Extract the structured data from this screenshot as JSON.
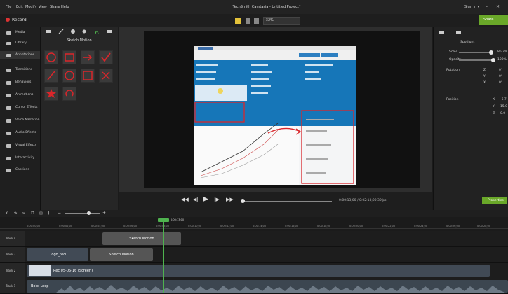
{
  "menubar": {
    "items": [
      "File",
      "Edit",
      "Modify",
      "View",
      "Share",
      "Help"
    ],
    "title": "TechSmith Camtasia - Untitled Project*",
    "user": "Sign In ▾"
  },
  "toolbar": {
    "record_label": "Record",
    "zoom": "32%",
    "share_label": "Share"
  },
  "sidebar": {
    "items": [
      {
        "label": "Media"
      },
      {
        "label": "Library"
      },
      {
        "label": "Annotations"
      },
      {
        "label": "Transitions"
      },
      {
        "label": "Behaviors"
      },
      {
        "label": "Animations"
      },
      {
        "label": "Cursor Effects"
      },
      {
        "label": "Voice Narration"
      },
      {
        "label": "Audio Effects"
      },
      {
        "label": "Visual Effects"
      },
      {
        "label": "Interactivity"
      },
      {
        "label": "Captions"
      }
    ]
  },
  "annotations": {
    "panel_title": "Sketch Motion",
    "accent": "#d9262b"
  },
  "rightpanel": {
    "title": "Spotlight",
    "scale_label": "Scale",
    "scale_value": "85.7%",
    "opacity_label": "Opacity",
    "opacity_value": "100%",
    "rotation_label": "Rotation",
    "rot_values": [
      "0°",
      "0°",
      "0°"
    ],
    "position_label": "Position",
    "pos_values": [
      "-6.7",
      "15.0",
      "0.0"
    ],
    "axis_labels": [
      "X",
      "Y",
      "Z"
    ],
    "properties_label": "Properties"
  },
  "playback": {
    "time": "0:00:13;00 / 0:02:13;00  30fps"
  },
  "screenshot": {
    "header_text": "Find, compare and share the latest OECD data: charts, maps, tables and related publications",
    "search_label": "Browse by",
    "topic_btn": "Topic",
    "country_btn": "Country",
    "topics_left": [
      "Agriculture",
      "Development",
      "Economy",
      "Education",
      "Employment"
    ],
    "topics_mid": [
      "Energy",
      "Environment",
      "Finance",
      "Government",
      "Health"
    ],
    "topics_right": [
      "Innovation and Technology",
      "Jobs",
      "Society"
    ],
    "right_col_labels": [
      "Selected indicators",
      "Related topic",
      "Statistical Insight",
      "Webcast : GIG"
    ]
  },
  "timeline": {
    "ticks": [
      "0:00:00;00",
      "0:00:02;00",
      "0:00:04;00",
      "0:00:06;00",
      "0:00:08;00",
      "0:00:10;00",
      "0:00:12;00",
      "0:00:14;00",
      "0:00:16;00",
      "0:00:18;00",
      "0:00:20;00",
      "0:00:22;00",
      "0:00:24;00",
      "0:00:26;00",
      "0:00:28;00"
    ],
    "playhead_time": "0:00:13;00",
    "tracks": [
      {
        "name": "Track 4"
      },
      {
        "name": "Track 3"
      },
      {
        "name": "Track 2"
      },
      {
        "name": "Track 1"
      }
    ],
    "clips": {
      "sketch1": "Sketch Motion",
      "logo": "logo_tecu",
      "sketch2": "Sketch Motion",
      "rec": "Rec 05-05-16 (Screen)",
      "audio": "Bolo_Loop"
    }
  }
}
